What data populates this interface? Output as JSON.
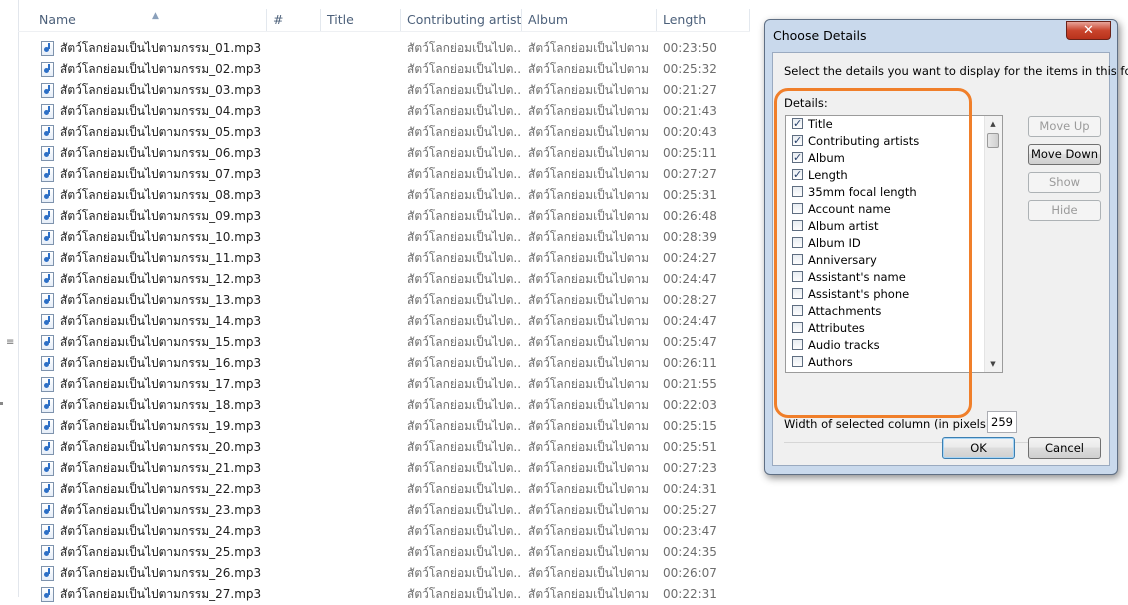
{
  "columns": {
    "name": "Name",
    "number": "#",
    "title": "Title",
    "contributing_artists": "Contributing artists",
    "album": "Album",
    "length": "Length"
  },
  "files": [
    {
      "name": "สัตว์โลกย่อมเป็นไปตามกรรม_01.mp3",
      "artist": "สัตว์โลกย่อมเป็นไปต...",
      "album": "สัตว์โลกย่อมเป็นไปตาม...",
      "length": "00:23:50"
    },
    {
      "name": "สัตว์โลกย่อมเป็นไปตามกรรม_02.mp3",
      "artist": "สัตว์โลกย่อมเป็นไปต...",
      "album": "สัตว์โลกย่อมเป็นไปตาม...",
      "length": "00:25:32"
    },
    {
      "name": "สัตว์โลกย่อมเป็นไปตามกรรม_03.mp3",
      "artist": "สัตว์โลกย่อมเป็นไปต...",
      "album": "สัตว์โลกย่อมเป็นไปตาม...",
      "length": "00:21:27"
    },
    {
      "name": "สัตว์โลกย่อมเป็นไปตามกรรม_04.mp3",
      "artist": "สัตว์โลกย่อมเป็นไปต...",
      "album": "สัตว์โลกย่อมเป็นไปตาม...",
      "length": "00:21:43"
    },
    {
      "name": "สัตว์โลกย่อมเป็นไปตามกรรม_05.mp3",
      "artist": "สัตว์โลกย่อมเป็นไปต...",
      "album": "สัตว์โลกย่อมเป็นไปตาม...",
      "length": "00:20:43"
    },
    {
      "name": "สัตว์โลกย่อมเป็นไปตามกรรม_06.mp3",
      "artist": "สัตว์โลกย่อมเป็นไปต...",
      "album": "สัตว์โลกย่อมเป็นไปตาม...",
      "length": "00:25:11"
    },
    {
      "name": "สัตว์โลกย่อมเป็นไปตามกรรม_07.mp3",
      "artist": "สัตว์โลกย่อมเป็นไปต...",
      "album": "สัตว์โลกย่อมเป็นไปตาม...",
      "length": "00:27:27"
    },
    {
      "name": "สัตว์โลกย่อมเป็นไปตามกรรม_08.mp3",
      "artist": "สัตว์โลกย่อมเป็นไปต...",
      "album": "สัตว์โลกย่อมเป็นไปตาม...",
      "length": "00:25:31"
    },
    {
      "name": "สัตว์โลกย่อมเป็นไปตามกรรม_09.mp3",
      "artist": "สัตว์โลกย่อมเป็นไปต...",
      "album": "สัตว์โลกย่อมเป็นไปตาม...",
      "length": "00:26:48"
    },
    {
      "name": "สัตว์โลกย่อมเป็นไปตามกรรม_10.mp3",
      "artist": "สัตว์โลกย่อมเป็นไปต...",
      "album": "สัตว์โลกย่อมเป็นไปตาม...",
      "length": "00:28:39"
    },
    {
      "name": "สัตว์โลกย่อมเป็นไปตามกรรม_11.mp3",
      "artist": "สัตว์โลกย่อมเป็นไปต...",
      "album": "สัตว์โลกย่อมเป็นไปตาม...",
      "length": "00:24:27"
    },
    {
      "name": "สัตว์โลกย่อมเป็นไปตามกรรม_12.mp3",
      "artist": "สัตว์โลกย่อมเป็นไปต...",
      "album": "สัตว์โลกย่อมเป็นไปตาม...",
      "length": "00:24:47"
    },
    {
      "name": "สัตว์โลกย่อมเป็นไปตามกรรม_13.mp3",
      "artist": "สัตว์โลกย่อมเป็นไปต...",
      "album": "สัตว์โลกย่อมเป็นไปตาม...",
      "length": "00:28:27"
    },
    {
      "name": "สัตว์โลกย่อมเป็นไปตามกรรม_14.mp3",
      "artist": "สัตว์โลกย่อมเป็นไปต...",
      "album": "สัตว์โลกย่อมเป็นไปตาม...",
      "length": "00:24:47"
    },
    {
      "name": "สัตว์โลกย่อมเป็นไปตามกรรม_15.mp3",
      "artist": "สัตว์โลกย่อมเป็นไปต...",
      "album": "สัตว์โลกย่อมเป็นไปตาม...",
      "length": "00:25:47"
    },
    {
      "name": "สัตว์โลกย่อมเป็นไปตามกรรม_16.mp3",
      "artist": "สัตว์โลกย่อมเป็นไปต...",
      "album": "สัตว์โลกย่อมเป็นไปตาม...",
      "length": "00:26:11"
    },
    {
      "name": "สัตว์โลกย่อมเป็นไปตามกรรม_17.mp3",
      "artist": "สัตว์โลกย่อมเป็นไปต...",
      "album": "สัตว์โลกย่อมเป็นไปตาม...",
      "length": "00:21:55"
    },
    {
      "name": "สัตว์โลกย่อมเป็นไปตามกรรม_18.mp3",
      "artist": "สัตว์โลกย่อมเป็นไปต...",
      "album": "สัตว์โลกย่อมเป็นไปตาม...",
      "length": "00:22:03"
    },
    {
      "name": "สัตว์โลกย่อมเป็นไปตามกรรม_19.mp3",
      "artist": "สัตว์โลกย่อมเป็นไปต...",
      "album": "สัตว์โลกย่อมเป็นไปตาม...",
      "length": "00:25:15"
    },
    {
      "name": "สัตว์โลกย่อมเป็นไปตามกรรม_20.mp3",
      "artist": "สัตว์โลกย่อมเป็นไปต...",
      "album": "สัตว์โลกย่อมเป็นไปตาม...",
      "length": "00:25:51"
    },
    {
      "name": "สัตว์โลกย่อมเป็นไปตามกรรม_21.mp3",
      "artist": "สัตว์โลกย่อมเป็นไปต...",
      "album": "สัตว์โลกย่อมเป็นไปตาม...",
      "length": "00:27:23"
    },
    {
      "name": "สัตว์โลกย่อมเป็นไปตามกรรม_22.mp3",
      "artist": "สัตว์โลกย่อมเป็นไปต...",
      "album": "สัตว์โลกย่อมเป็นไปตาม...",
      "length": "00:24:31"
    },
    {
      "name": "สัตว์โลกย่อมเป็นไปตามกรรม_23.mp3",
      "artist": "สัตว์โลกย่อมเป็นไปต...",
      "album": "สัตว์โลกย่อมเป็นไปตาม...",
      "length": "00:25:27"
    },
    {
      "name": "สัตว์โลกย่อมเป็นไปตามกรรม_24.mp3",
      "artist": "สัตว์โลกย่อมเป็นไปต...",
      "album": "สัตว์โลกย่อมเป็นไปตาม...",
      "length": "00:23:47"
    },
    {
      "name": "สัตว์โลกย่อมเป็นไปตามกรรม_25.mp3",
      "artist": "สัตว์โลกย่อมเป็นไปต...",
      "album": "สัตว์โลกย่อมเป็นไปตาม...",
      "length": "00:24:35"
    },
    {
      "name": "สัตว์โลกย่อมเป็นไปตามกรรม_26.mp3",
      "artist": "สัตว์โลกย่อมเป็นไปต...",
      "album": "สัตว์โลกย่อมเป็นไปตาม...",
      "length": "00:26:07"
    },
    {
      "name": "สัตว์โลกย่อมเป็นไปตามกรรม_27.mp3",
      "artist": "สัตว์โลกย่อมเป็นไปต...",
      "album": "สัตว์โลกย่อมเป็นไปตาม...",
      "length": "00:22:31"
    }
  ],
  "dialog": {
    "title": "Choose Details",
    "close_label": "✕",
    "instruction": "Select the details you want to display for the items in this folder.",
    "details_label": "Details:",
    "details": [
      {
        "label": "Title",
        "checked": true
      },
      {
        "label": "Contributing artists",
        "checked": true
      },
      {
        "label": "Album",
        "checked": true
      },
      {
        "label": "Length",
        "checked": true
      },
      {
        "label": "35mm focal length",
        "checked": false
      },
      {
        "label": "Account name",
        "checked": false
      },
      {
        "label": "Album artist",
        "checked": false
      },
      {
        "label": "Album ID",
        "checked": false
      },
      {
        "label": "Anniversary",
        "checked": false
      },
      {
        "label": "Assistant's name",
        "checked": false
      },
      {
        "label": "Assistant's phone",
        "checked": false
      },
      {
        "label": "Attachments",
        "checked": false
      },
      {
        "label": "Attributes",
        "checked": false
      },
      {
        "label": "Audio tracks",
        "checked": false
      },
      {
        "label": "Authors",
        "checked": false
      }
    ],
    "buttons": {
      "move_up": "Move Up",
      "move_down": "Move Down",
      "show": "Show",
      "hide": "Hide",
      "ok": "OK",
      "cancel": "Cancel"
    },
    "width_label": "Width of selected column (in pixels):",
    "width_value": "259"
  },
  "colors": {
    "highlight": "#f07f2a",
    "dialog_frame": "#c9d9ec",
    "close_button": "#c9442c"
  },
  "icons": {
    "file": "audio-file-icon",
    "sort": "sort-ascending-icon",
    "scroll_up": "scroll-up-arrow-icon",
    "scroll_down": "scroll-down-arrow-icon"
  }
}
